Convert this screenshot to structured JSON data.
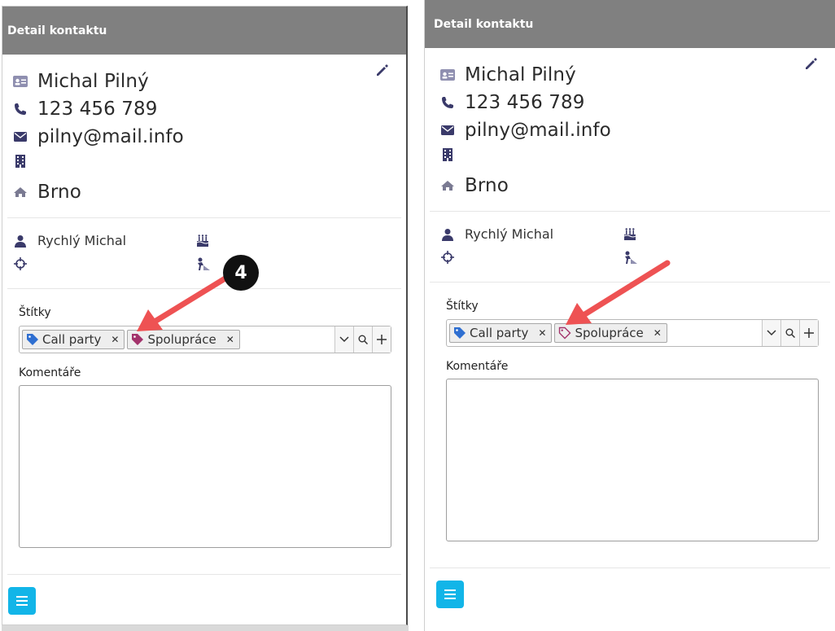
{
  "panels": [
    {
      "header": {
        "title": "Detail kontaktu"
      },
      "contact": {
        "name": "Michal Pilný",
        "phone": "123 456 789",
        "email": "pilny@mail.info",
        "company": "",
        "city": "Brno"
      },
      "info": {
        "owner": "Rychlý Michal",
        "location": "",
        "birthday": "",
        "role": ""
      },
      "tags_label": "Štítky",
      "tags": [
        {
          "label": "Call party",
          "color": "#2f6fd1",
          "icon": "tag-filled-icon"
        },
        {
          "label": "Spolupráce",
          "color": "#a3336b",
          "icon": "tag-filled-icon"
        }
      ],
      "comments_label": "Komentáře",
      "comments_value": "",
      "badge": "4"
    },
    {
      "header": {
        "title": "Detail kontaktu"
      },
      "contact": {
        "name": "Michal Pilný",
        "phone": "123 456 789",
        "email": "pilny@mail.info",
        "company": "",
        "city": "Brno"
      },
      "info": {
        "owner": "Rychlý Michal",
        "location": "",
        "birthday": "",
        "role": ""
      },
      "tags_label": "Štítky",
      "tags": [
        {
          "label": "Call party",
          "color": "#2f6fd1",
          "icon": "tag-filled-icon"
        },
        {
          "label": "Spolupráce",
          "color": "#a3336b",
          "icon": "tag-outline-icon"
        }
      ],
      "comments_label": "Komentáře",
      "comments_value": ""
    }
  ],
  "colors": {
    "header_bg": "#808080",
    "accent": "#12b5e8",
    "icon": "#3a3a6a",
    "arrow": "#ee5253"
  }
}
